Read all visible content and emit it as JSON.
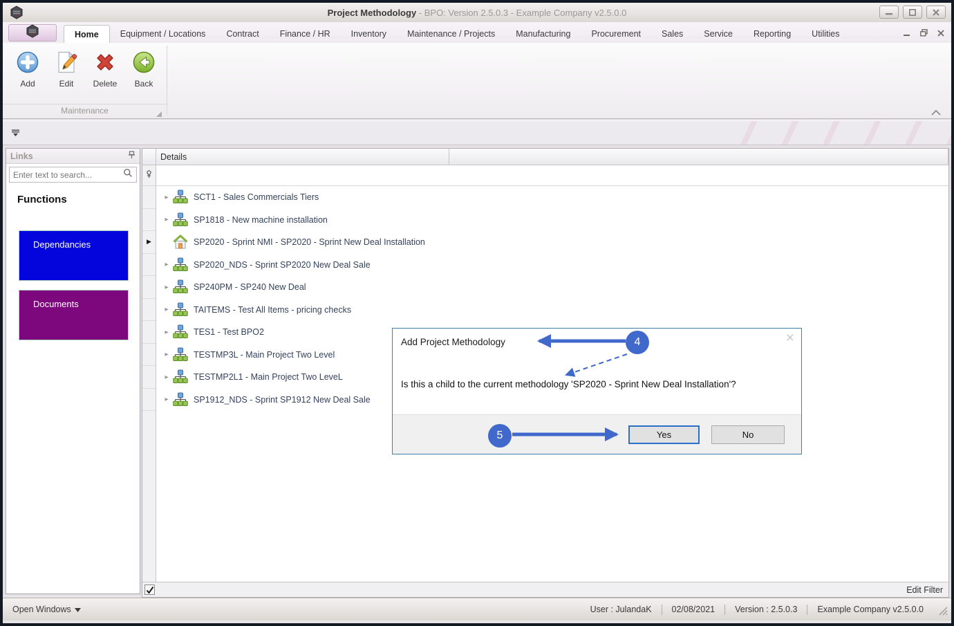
{
  "window": {
    "title": "Project Methodology",
    "title_suffix": " - BPO: Version 2.5.0.3 - Example Company v2.5.0.0"
  },
  "ribbon": {
    "tabs": [
      "Home",
      "Equipment / Locations",
      "Contract",
      "Finance / HR",
      "Inventory",
      "Maintenance / Projects",
      "Manufacturing",
      "Procurement",
      "Sales",
      "Service",
      "Reporting",
      "Utilities"
    ],
    "active_tab_index": 0,
    "buttons": [
      {
        "label": "Add",
        "icon": "add-icon"
      },
      {
        "label": "Edit",
        "icon": "edit-icon"
      },
      {
        "label": "Delete",
        "icon": "delete-icon"
      },
      {
        "label": "Back",
        "icon": "back-icon"
      }
    ],
    "group_label": "Maintenance"
  },
  "links_panel": {
    "title": "Links",
    "search_placeholder": "Enter text to search...",
    "heading": "Functions",
    "functions": [
      {
        "label": "Dependancies",
        "color": "#0404dd"
      },
      {
        "label": "Documents",
        "color": "#7d077d"
      }
    ]
  },
  "grid": {
    "column_header": "Details",
    "rows": [
      {
        "text": "SCT1 - Sales Commercials Tiers",
        "icon": "org-chart",
        "expandable": true,
        "selected": false
      },
      {
        "text": "SP1818 - New machine installation",
        "icon": "org-chart",
        "expandable": true,
        "selected": false
      },
      {
        "text": "SP2020 - Sprint NMI - SP2020 - Sprint New Deal Installation",
        "icon": "home",
        "expandable": false,
        "selected": true
      },
      {
        "text": "SP2020_NDS - Sprint SP2020 New Deal Sale",
        "icon": "org-chart",
        "expandable": true,
        "selected": false
      },
      {
        "text": "SP240PM - SP240 New Deal",
        "icon": "org-chart",
        "expandable": true,
        "selected": false
      },
      {
        "text": "TAITEMS - Test All Items - pricing checks",
        "icon": "org-chart",
        "expandable": true,
        "selected": false
      },
      {
        "text": "TES1 - Test BPO2",
        "icon": "org-chart",
        "expandable": true,
        "selected": false
      },
      {
        "text": "TESTMP3L - Main Project Two Level",
        "icon": "org-chart",
        "expandable": true,
        "selected": false
      },
      {
        "text": "TESTMP2L1 - Main Project Two LeveL",
        "icon": "org-chart",
        "expandable": true,
        "selected": false
      },
      {
        "text": "SP1912_NDS - Sprint SP1912 New Deal Sale",
        "icon": "org-chart",
        "expandable": true,
        "selected": false
      }
    ],
    "checkbox_checked": "✓",
    "edit_filter_label": "Edit Filter"
  },
  "dialog": {
    "title": "Add Project Methodology",
    "message": "Is this a child to the current methodology 'SP2020 - Sprint New Deal Installation'?",
    "yes_label": "Yes",
    "no_label": "No"
  },
  "annotations": {
    "color": "#4169cb",
    "step4": "4",
    "step5": "5"
  },
  "statusbar": {
    "open_windows": "Open Windows",
    "user": "User : JulandaK",
    "date": "02/08/2021",
    "version": "Version : 2.5.0.3",
    "company": "Example Company v2.5.0.0"
  }
}
